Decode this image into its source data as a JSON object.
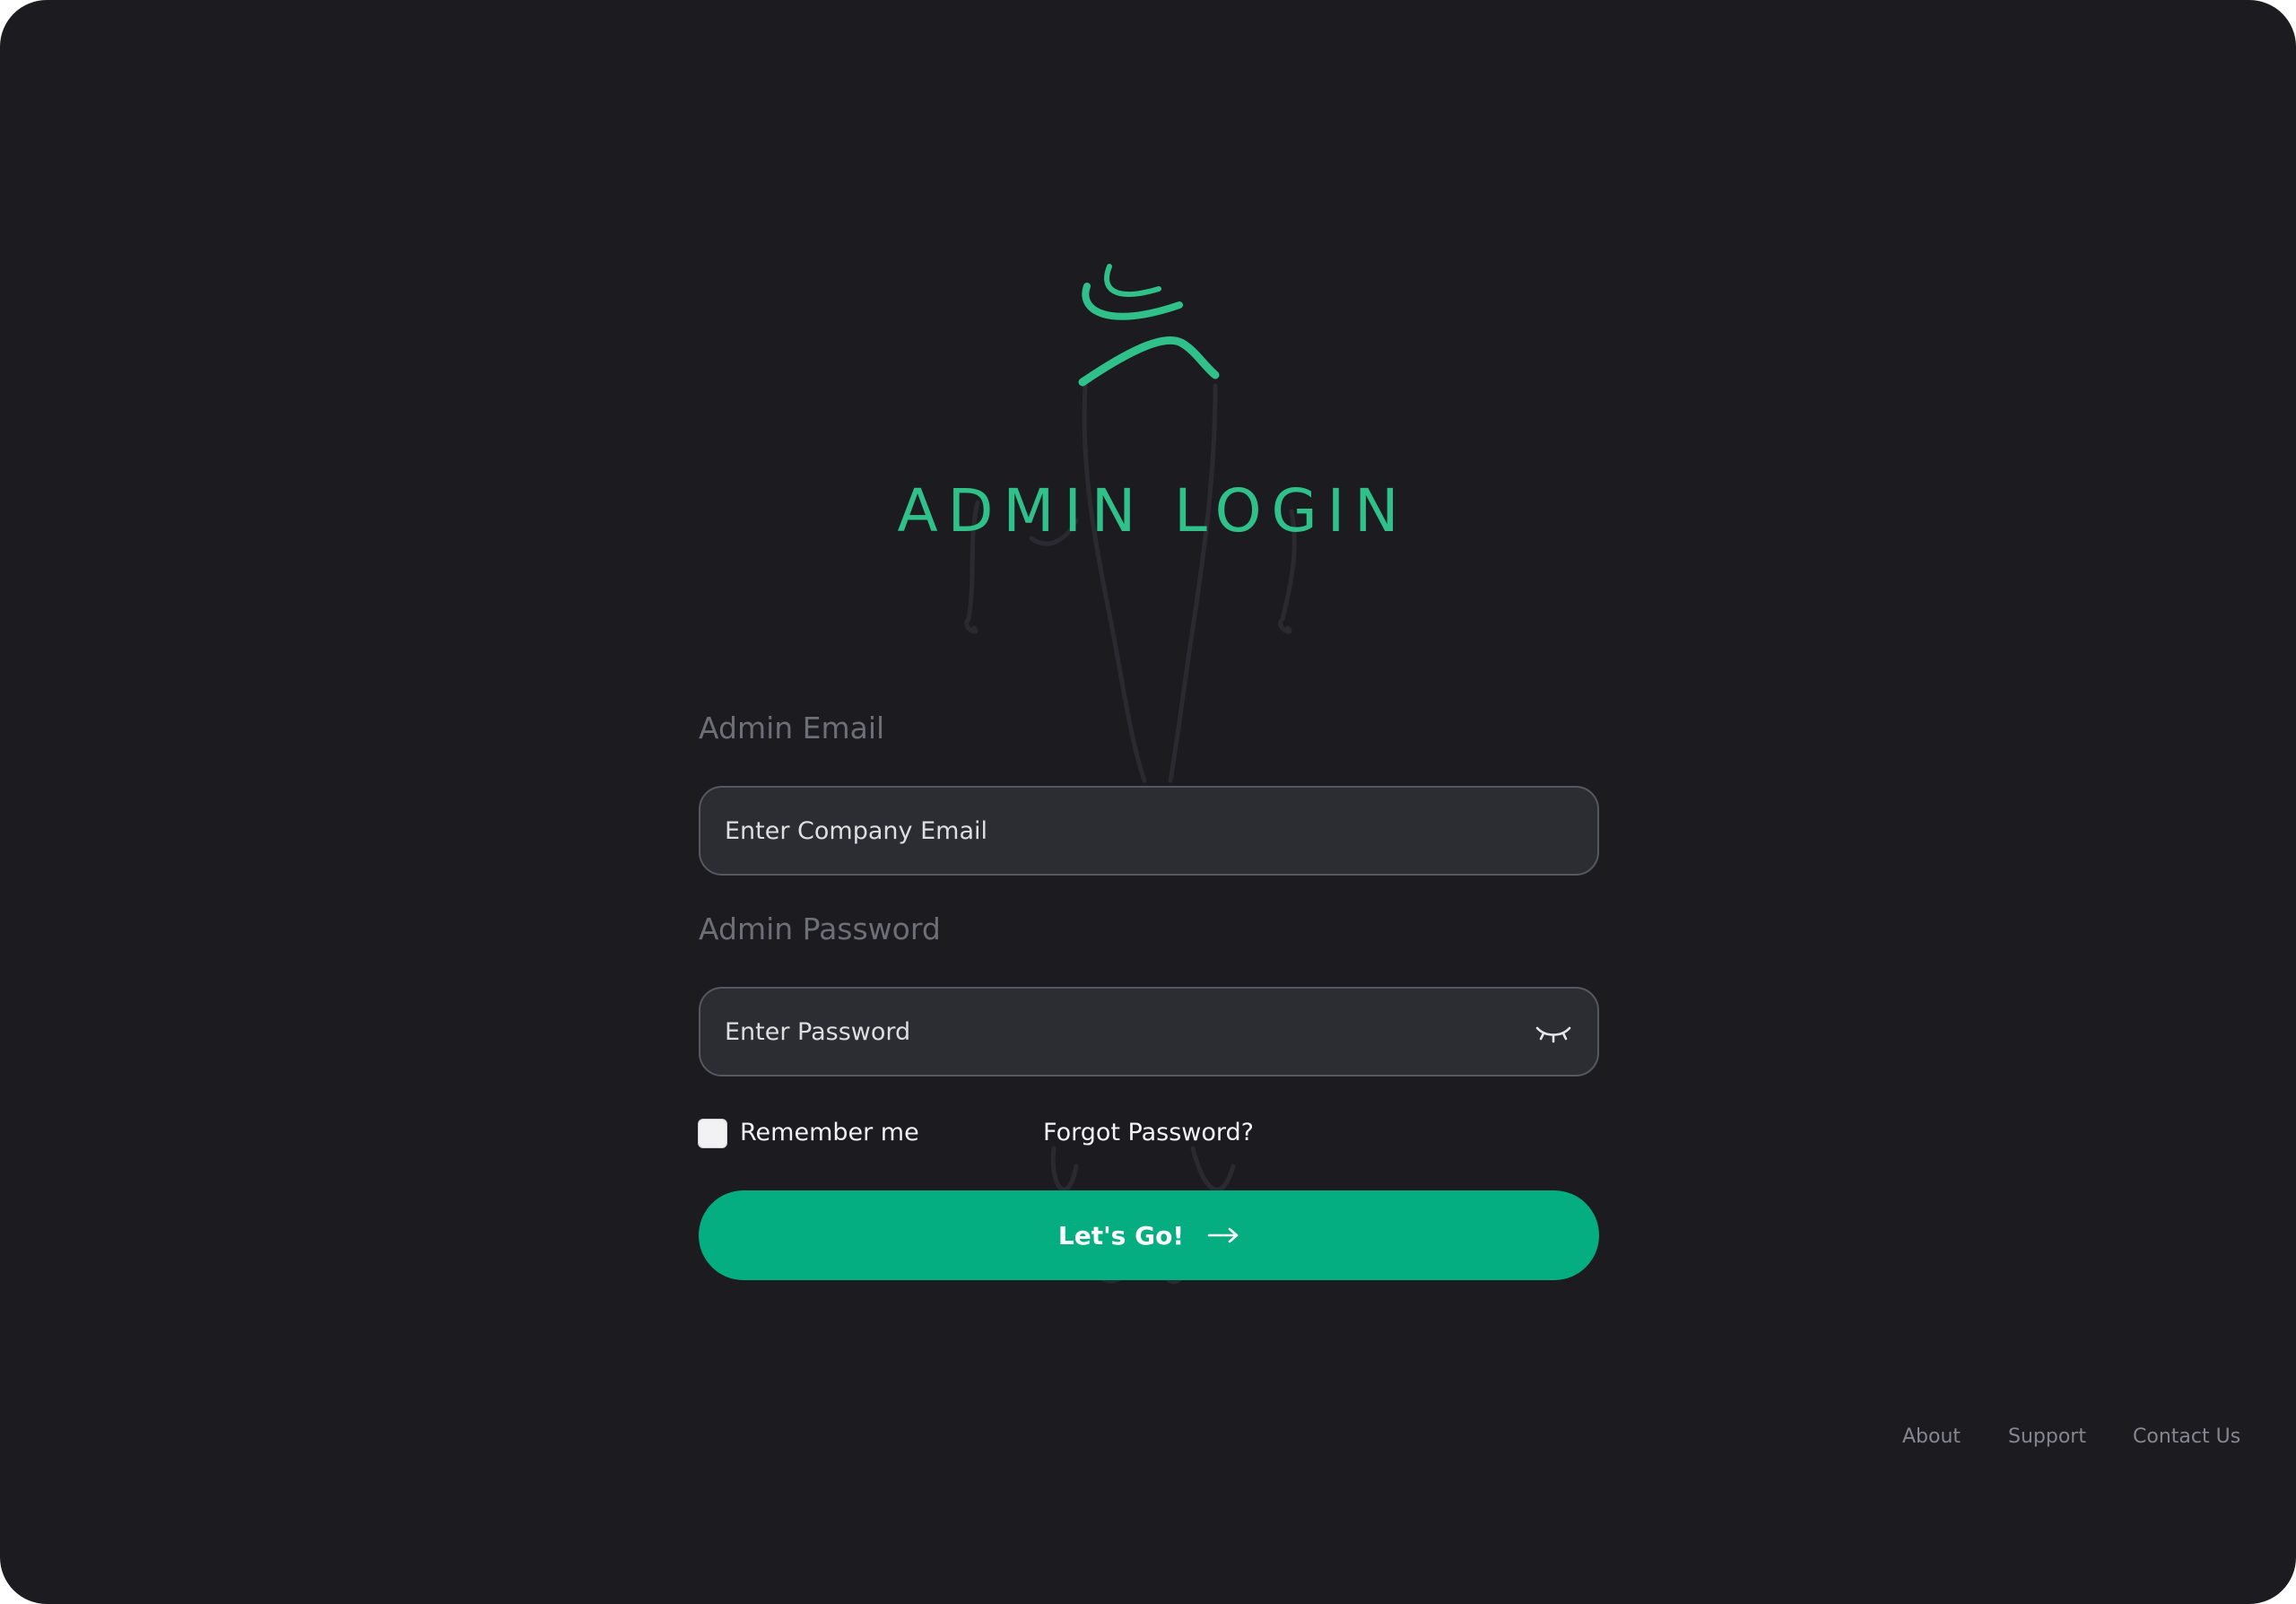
{
  "header": {
    "title": "ADMIN LOGIN",
    "logo_icon": "leaf-swirl-logo-icon",
    "accent_color": "#30c08a"
  },
  "form": {
    "email": {
      "label": "Admin Email",
      "placeholder": "Enter Company Email",
      "value": ""
    },
    "password": {
      "label": "Admin Password",
      "placeholder": "Enter Password",
      "value": "",
      "toggle_icon": "eye-closed-icon"
    },
    "remember_label": "Remember me",
    "remember_checked": false,
    "forgot_label": "Forgot Password?",
    "submit": {
      "label": "Let's Go!",
      "icon": "arrow-right-icon",
      "color": "#05ae80"
    }
  },
  "footer": {
    "links": [
      {
        "label": "About"
      },
      {
        "label": "Support"
      },
      {
        "label": "Contact Us"
      }
    ]
  },
  "theme": {
    "background": "#1b1b20",
    "input_background": "#2c2c33"
  }
}
